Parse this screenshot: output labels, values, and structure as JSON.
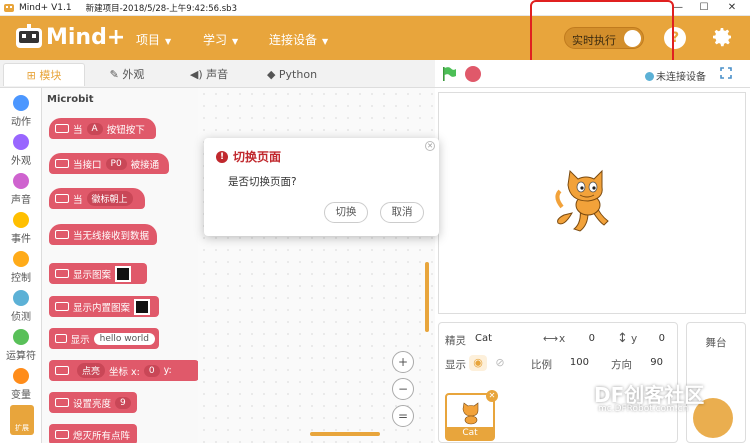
{
  "titlebar": {
    "app": "Mind+ V1.1",
    "file": "新建项目-2018/5/28-上午9:42:56.sb3",
    "min": "—",
    "max": "☐",
    "close": "✕"
  },
  "topbar": {
    "brand": "Mind+",
    "menu": [
      "项目",
      "学习",
      "连接设备"
    ],
    "toggle_label": "实时执行",
    "help": "?"
  },
  "tabs": [
    {
      "label": "模块",
      "icon": "puzzle-icon"
    },
    {
      "label": "外观",
      "icon": "brush-icon"
    },
    {
      "label": "声音",
      "icon": "speaker-icon"
    },
    {
      "label": "Python",
      "icon": "python-icon"
    }
  ],
  "categories": [
    {
      "label": "动作",
      "color": "#4c97ff"
    },
    {
      "label": "外观",
      "color": "#9966ff"
    },
    {
      "label": "声音",
      "color": "#cf63cf"
    },
    {
      "label": "事件",
      "color": "#ffbf00"
    },
    {
      "label": "控制",
      "color": "#ffab19"
    },
    {
      "label": "侦测",
      "color": "#5cb1d6"
    },
    {
      "label": "运算符",
      "color": "#59c059"
    },
    {
      "label": "变量",
      "color": "#ff8c1a"
    }
  ],
  "extension_label": "扩展",
  "palette": {
    "title": "Microbit",
    "blocks": {
      "b1": {
        "pre": "当",
        "field": "A",
        "post": "按钮按下"
      },
      "b2": {
        "pre": "当接口",
        "field": "P0",
        "post": "被接通"
      },
      "b3": {
        "pre": "当",
        "field": "徽标朝上"
      },
      "b4": {
        "pre": "当无线接收到数据"
      },
      "b5": {
        "pre": "显示图案"
      },
      "b6": {
        "pre": "显示内置图案"
      },
      "b7": {
        "pre": "显示",
        "field": "hello world"
      },
      "b8": {
        "pre": "点亮",
        "mid": "坐标 x:",
        "field": "0",
        "post": "y:"
      },
      "b9": {
        "pre": "设置亮度",
        "field": "9"
      },
      "b10": {
        "pre": "熄灭所有点阵"
      }
    }
  },
  "zoom": {
    "in": "+",
    "out": "−",
    "reset": "="
  },
  "stage_header": {
    "connection": "未连接设备"
  },
  "sprite_panel": {
    "sprite_label": "精灵",
    "sprite_name": "Cat",
    "x_label": "x",
    "x": "0",
    "y_label": "y",
    "y": "0",
    "show_label": "显示",
    "size_label": "比例",
    "size": "100",
    "direction_label": "方向",
    "direction": "90",
    "thumb_name": "Cat"
  },
  "stage_panel": {
    "label": "舞台"
  },
  "dialog": {
    "title": "切换页面",
    "message": "是否切换页面?",
    "confirm": "切换",
    "cancel": "取消"
  },
  "watermark": {
    "brand": "DF创客社区",
    "url": "mc.DFRobot.com.cn"
  },
  "colors": {
    "accent": "#e8a53c",
    "microbit_block": "#e0596a",
    "alert": "#c0282d"
  }
}
